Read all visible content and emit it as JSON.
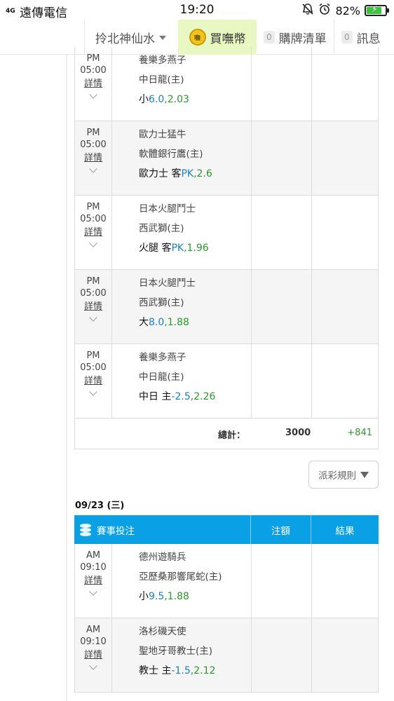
{
  "status_bar": {
    "signal": "4G",
    "carrier": "遠傳電信",
    "time": "19:20",
    "battery": "82%",
    "battery_level": 0.82
  },
  "header": {
    "username": "拎北神仙水",
    "buy_coin": "買嘸幣",
    "coin_icon_text": "嘸",
    "cart_count": "0",
    "cart_label": "購牌清單",
    "msg_count": "0",
    "msg_label": "訊息"
  },
  "section1": {
    "bets": [
      {
        "ampm": "PM",
        "time": "05:00",
        "detail": "詳情",
        "away": "養樂多燕子",
        "home": "中日龍(主)",
        "pick_prefix": "小",
        "pick_line": "6.0",
        "pick_odds": ",2.03",
        "gray": false
      },
      {
        "ampm": "PM",
        "time": "05:00",
        "detail": "詳情",
        "away": "歐力士猛牛",
        "home": "軟體銀行鷹(主)",
        "pick_prefix": "歐力士 客",
        "pick_line": "PK",
        "pick_odds": ",2.6",
        "gray": true
      },
      {
        "ampm": "PM",
        "time": "05:00",
        "detail": "詳情",
        "away": "日本火腿鬥士",
        "home": "西武獅(主)",
        "pick_prefix": "火腿 客",
        "pick_line": "PK",
        "pick_odds": ",1.96",
        "gray": false
      },
      {
        "ampm": "PM",
        "time": "05:00",
        "detail": "詳情",
        "away": "日本火腿鬥士",
        "home": "西武獅(主)",
        "pick_prefix": "大",
        "pick_line": "8.0",
        "pick_odds": ",1.88",
        "gray": true
      },
      {
        "ampm": "PM",
        "time": "05:00",
        "detail": "詳情",
        "away": "養樂多燕子",
        "home": "中日龍(主)",
        "pick_prefix": "中日 主",
        "pick_line": "-2.5",
        "pick_odds": ",2.26",
        "gray": false
      }
    ],
    "total_label": "總計：",
    "total_amount": "3000",
    "total_result": "+841"
  },
  "rule_button": "派彩規則",
  "section2": {
    "date": "09/23 (三)",
    "head_event": "賽事投注",
    "head_amount": "注額",
    "head_result": "結果",
    "bets": [
      {
        "ampm": "AM",
        "time": "09:10",
        "detail": "詳情",
        "away": "德州遊騎兵",
        "home": "亞歷桑那響尾蛇(主)",
        "pick_prefix": "小",
        "pick_line": "9.5",
        "pick_odds": ",1.88",
        "gray": false
      },
      {
        "ampm": "AM",
        "time": "09:10",
        "detail": "詳情",
        "away": "洛杉磯天使",
        "home": "聖地牙哥教士(主)",
        "pick_prefix": "教士 主",
        "pick_line": "-1.5",
        "pick_odds": ",2.12",
        "gray": true
      }
    ]
  }
}
